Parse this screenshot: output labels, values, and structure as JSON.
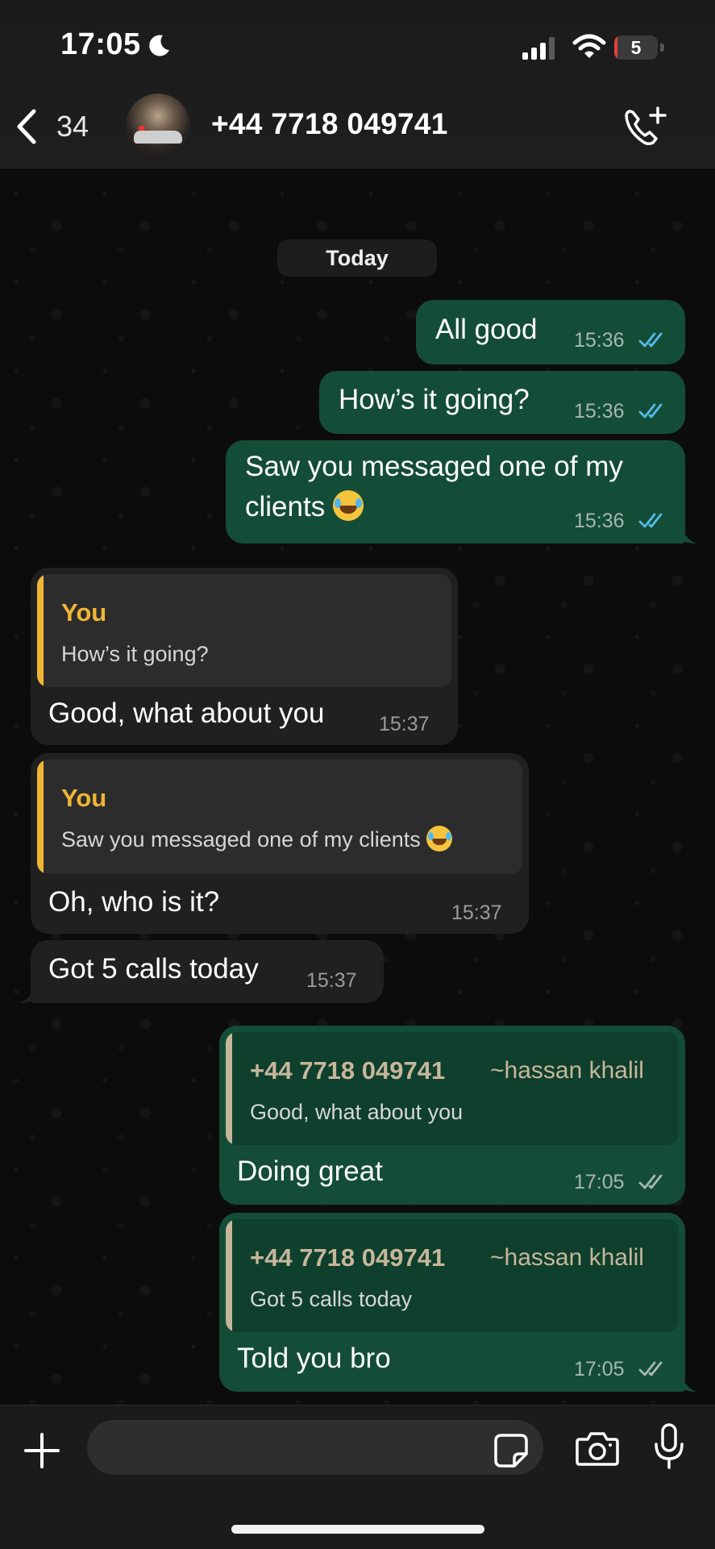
{
  "status_bar": {
    "time": "17:05",
    "battery_level": "5"
  },
  "header": {
    "back_count": "34",
    "contact_name": "+44 7718 049741"
  },
  "chat": {
    "date_separator": "Today",
    "messages": [
      {
        "direction": "outgoing",
        "text": "All good",
        "time": "15:36",
        "status": "read"
      },
      {
        "direction": "outgoing",
        "text": "How’s it going?",
        "time": "15:36",
        "status": "read"
      },
      {
        "direction": "outgoing",
        "text_line1": "Saw you messaged one of my",
        "text_line2": "clients",
        "emoji": "face-with-tears-of-joy",
        "time": "15:36",
        "status": "read"
      },
      {
        "direction": "incoming",
        "quote_author": "You",
        "quote_text": "How’s it going?",
        "text": "Good, what about you",
        "time": "15:37"
      },
      {
        "direction": "incoming",
        "quote_author": "You",
        "quote_text": "Saw you messaged one of my clients",
        "quote_emoji": "face-with-tears-of-joy",
        "text": "Oh, who is it?",
        "time": "15:37"
      },
      {
        "direction": "incoming",
        "text": "Got 5 calls today",
        "time": "15:37"
      },
      {
        "direction": "outgoing",
        "quote_author": "+44 7718 049741",
        "quote_author_sub": "~hassan khalil",
        "quote_text": "Good, what about you",
        "text": "Doing great",
        "time": "17:05",
        "status": "delivered"
      },
      {
        "direction": "outgoing",
        "quote_author": "+44 7718 049741",
        "quote_author_sub": "~hassan khalil",
        "quote_text": "Got 5 calls today",
        "text": "Told you bro",
        "time": "17:05",
        "status": "delivered"
      }
    ]
  },
  "composer": {
    "placeholder": ""
  },
  "colors": {
    "outgoing_bubble": "#144d37",
    "incoming_bubble": "#202020",
    "quote_bar_you": "#f0b535",
    "quote_author_you": "#f0b535",
    "quote_bar_contact": "#c6b79b",
    "quote_author_contact": "#c6b79b",
    "read_ticks": "#53bdeb",
    "delivered_ticks": "#a6b8ae"
  }
}
